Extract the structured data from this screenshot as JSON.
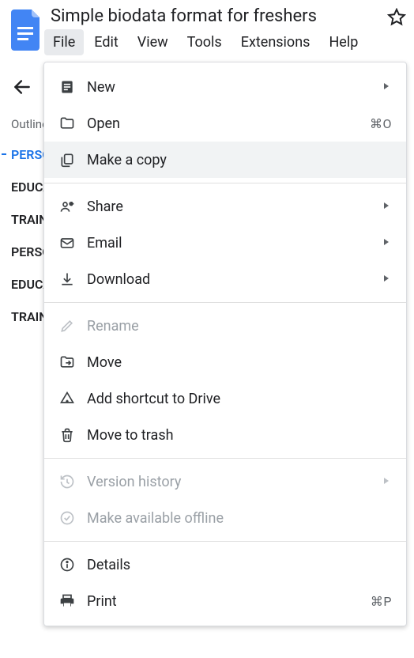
{
  "doc": {
    "title": "Simple biodata format for freshers"
  },
  "menubar": {
    "file": "File",
    "edit": "Edit",
    "view": "View",
    "tools": "Tools",
    "extensions": "Extensions",
    "help": "Help"
  },
  "outline": {
    "heading": "Outline",
    "items": [
      "PERSONAL",
      "EDUCATION",
      "TRAINING",
      "PERSONAL",
      "EDUCATION",
      "TRAINING"
    ]
  },
  "file_menu": {
    "new": "New",
    "open": "Open",
    "open_shortcut": "⌘O",
    "make_copy": "Make a copy",
    "share": "Share",
    "email": "Email",
    "download": "Download",
    "rename": "Rename",
    "move": "Move",
    "add_shortcut": "Add shortcut to Drive",
    "move_to_trash": "Move to trash",
    "version_history": "Version history",
    "available_offline": "Make available offline",
    "details": "Details",
    "print": "Print",
    "print_shortcut": "⌘P"
  }
}
